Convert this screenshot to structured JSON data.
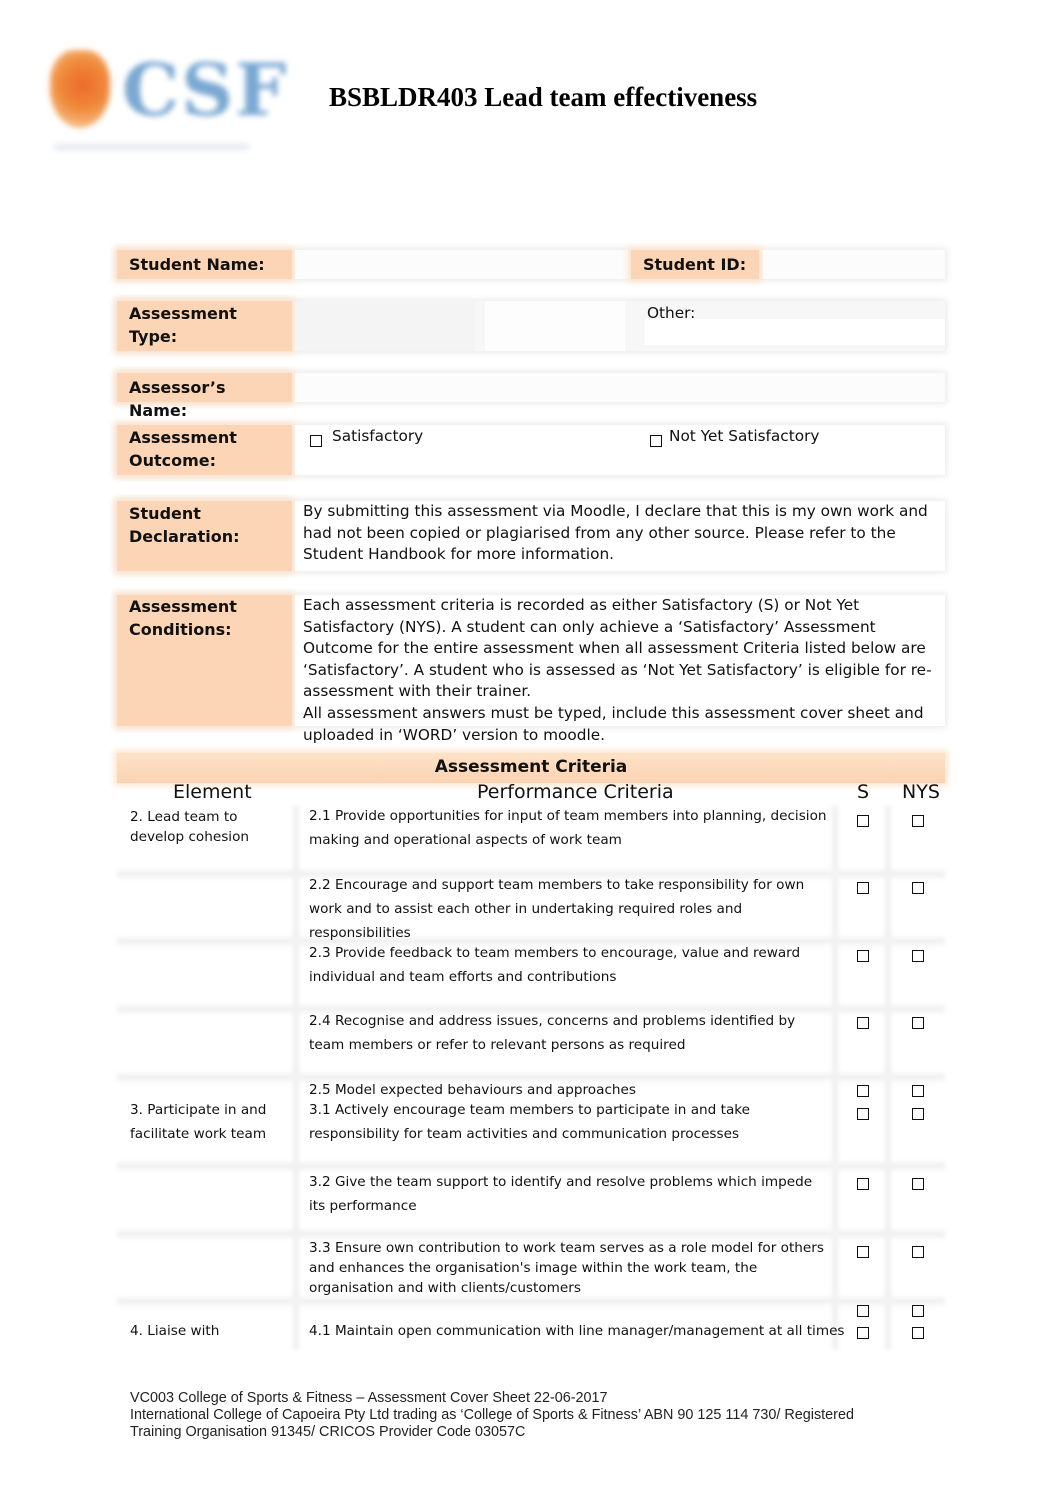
{
  "document": {
    "logo_text": "CSF",
    "title": "BSBLDR403 Lead team effectiveness"
  },
  "cover": {
    "student_name_label": "Student Name:",
    "student_name_value": "",
    "student_id_label": "Student ID:",
    "student_id_value": "",
    "assessment_type_label": "Assessment Type:",
    "assessment_type_value": "",
    "other_label": "Other:",
    "other_value": "",
    "assessor_name_label": "Assessor’s Name:",
    "assessor_name_value": "",
    "outcome_label": "Assessment Outcome:",
    "outcome_options": [
      {
        "label": "Satisfactory",
        "checked": false
      },
      {
        "label": "Not Yet Satisfactory",
        "checked": false
      }
    ],
    "declaration_label": "Student Declaration:",
    "declaration_text": "By submitting this assessment via Moodle, I declare that this is my own work and had not been copied or plagiarised from any other source. Please refer to the Student Handbook for more information.",
    "conditions_label": "Assessment Conditions:",
    "conditions_text_1": "Each assessment criteria is recorded as either Satisfactory (S) or Not Yet Satisfactory (NYS). A student can only achieve a ‘Satisfactory’ Assessment Outcome for the entire assessment when all assessment Criteria listed below are ‘Satisfactory’. A student who is assessed as ‘Not Yet Satisfactory’ is eligible for re-assessment with their trainer.",
    "conditions_text_2": "All assessment answers must be typed, include this assessment cover sheet and uploaded in ‘WORD’ version to moodle."
  },
  "criteria": {
    "heading": "Assessment Criteria",
    "columns": [
      "Element",
      "Performance Criteria",
      "S",
      "NYS"
    ],
    "rows": [
      {
        "element": "2. Lead team to develop cohesion",
        "criterion": "2.1 Provide opportunities for input of team members into planning, decision making and operational aspects of work team",
        "s": false,
        "nys": false
      },
      {
        "element": "",
        "criterion": "2.2 Encourage and support team members to take responsibility for own work and to assist each other in undertaking required roles and responsibilities",
        "s": false,
        "nys": false
      },
      {
        "element": "",
        "criterion": "2.3 Provide feedback to team members to encourage, value and reward individual and team efforts and contributions",
        "s": false,
        "nys": false
      },
      {
        "element": "",
        "criterion": "2.4 Recognise and address issues, concerns and problems identified by team members or refer to relevant persons as required",
        "s": false,
        "nys": false
      },
      {
        "element": "",
        "criterion": "2.5 Model expected behaviours and approaches",
        "s": false,
        "nys": false
      },
      {
        "element": "3. Participate in and facilitate work team",
        "criterion": "3.1 Actively encourage team members to participate in and take responsibility for team activities and communication processes",
        "s": false,
        "nys": false
      },
      {
        "element": "",
        "criterion": "3.2 Give the team support to identify and resolve problems which impede its performance",
        "s": false,
        "nys": false
      },
      {
        "element": "",
        "criterion": "3.3 Ensure own contribution to work team serves as a role model for others and enhances the organisation's image within the work team, the organisation and with clients/customers",
        "s": false,
        "nys": false
      },
      {
        "element": "",
        "criterion": "",
        "s": false,
        "nys": false
      },
      {
        "element": "4. Liaise with",
        "criterion": "4.1 Maintain open communication with line manager/management at all times",
        "s": false,
        "nys": false
      }
    ]
  },
  "footer": {
    "line1": "VC003 College of Sports & Fitness – Assessment Cover Sheet 22-06-2017",
    "line2": "International College of Capoeira Pty Ltd trading as ‘College of Sports & Fitness’ ABN 90 125 114 730/ Registered",
    "line3": "Training Organisation 91345/ CRICOS Provider Code 03057C"
  }
}
